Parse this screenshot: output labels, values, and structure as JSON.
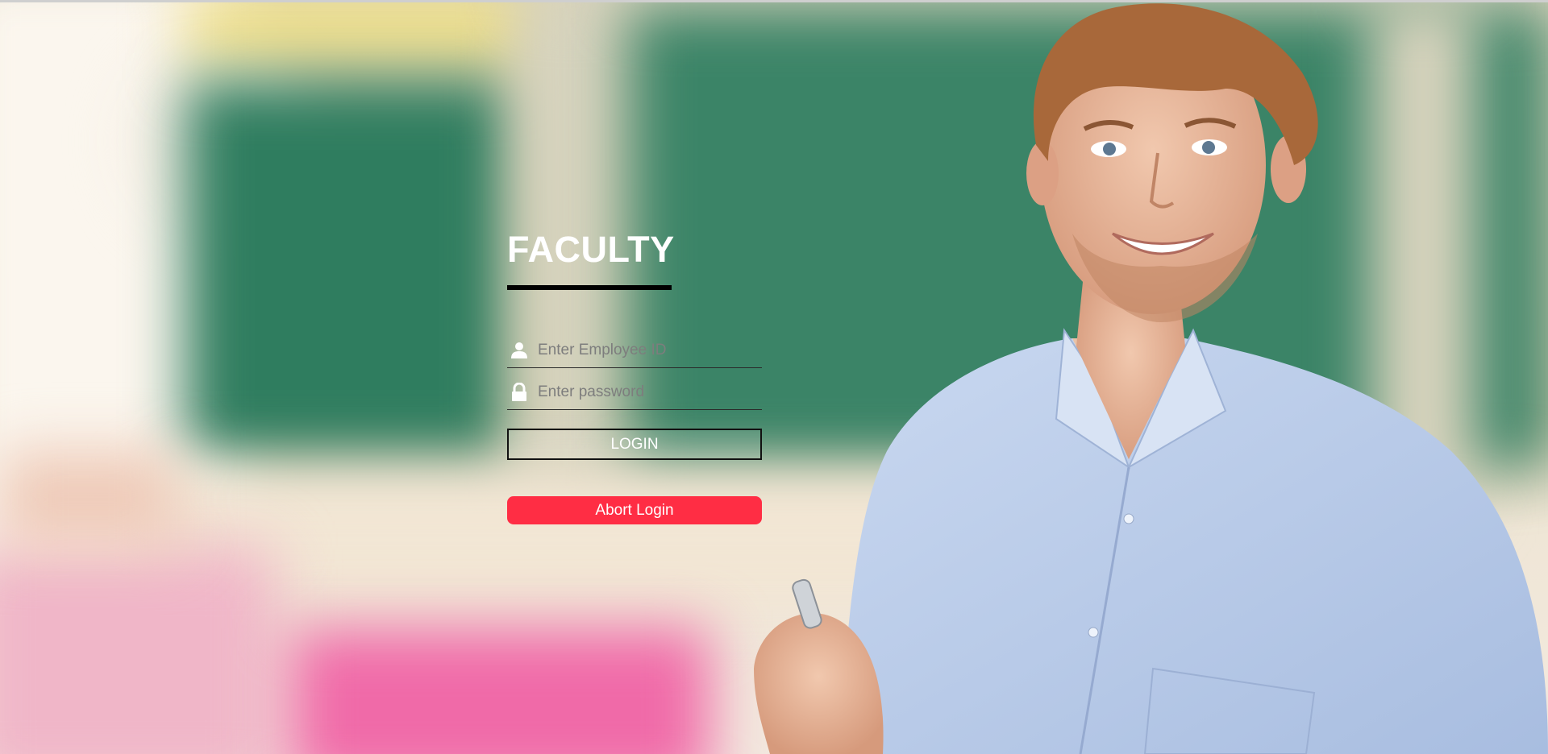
{
  "page": {
    "title": "FACULTY"
  },
  "form": {
    "employee_id": {
      "placeholder": "Enter Employee ID",
      "value": "",
      "icon": "user-icon"
    },
    "password": {
      "placeholder": "Enter password",
      "value": "",
      "icon": "lock-icon"
    },
    "login_label": "LOGIN",
    "abort_label": "Abort Login"
  },
  "colors": {
    "title": "#ffffff",
    "underline": "#000000",
    "abort_button": "#ff2d44",
    "login_border": "#111111"
  }
}
